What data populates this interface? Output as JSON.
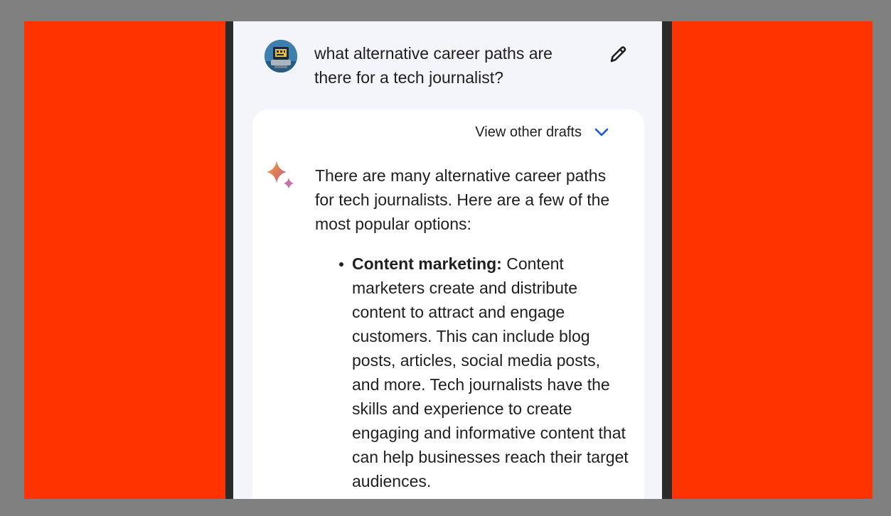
{
  "prompt": {
    "text": "what alternative career paths are there for a tech journalist?"
  },
  "response": {
    "drafts_label": "View other drafts",
    "intro": "There are many alternative career paths for tech journalists. Here are a few of the most popular options:",
    "items": [
      {
        "title": "Content marketing:",
        "body": " Content marketers create and distribute content to attract and engage customers. This can include blog posts, articles, social media posts, and more. Tech journalists have the skills and experience to create engaging and informative content that can help businesses reach their target audiences."
      }
    ]
  },
  "icons": {
    "avatar": "avatar-robot",
    "edit": "pencil-icon",
    "drafts_toggle": "chevron-down-icon",
    "assistant": "sparkle-icon"
  },
  "colors": {
    "backdrop": "#ff3300",
    "frame": "#808080",
    "phone_bezel": "#2b2b2b",
    "screen_bg": "#f3f5fb",
    "card_bg": "#ffffff",
    "text": "#1f1f1f",
    "accent_blue": "#1a56db"
  }
}
